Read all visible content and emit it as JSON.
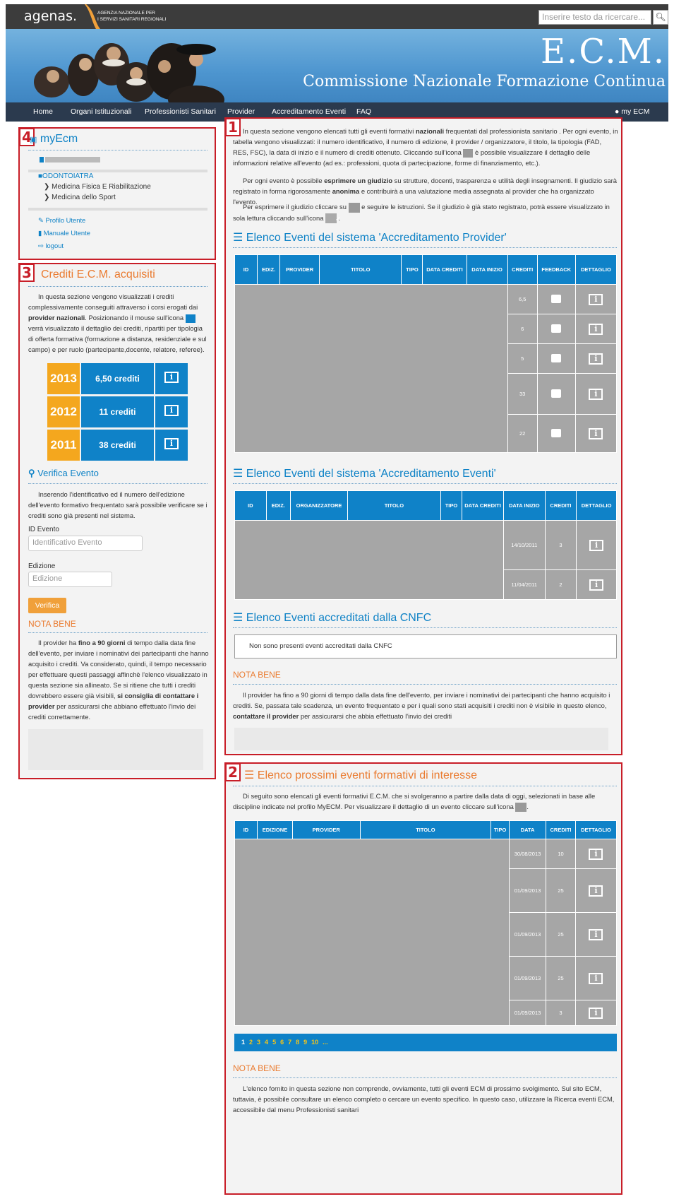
{
  "header": {
    "logo": "agenas.",
    "logo_sub_line1": "AGENZIA NAZIONALE PER",
    "logo_sub_line2": "I SERVIZI SANITARI REGIONALI",
    "search_placeholder": "Inserire testo da ricercare...",
    "banner_title": "E.C.M.",
    "banner_subtitle": "Commissione Nazionale Formazione Continua"
  },
  "nav": {
    "items": [
      "Home",
      "Organi Istituzionali",
      "Professionisti Sanitari",
      "Provider",
      "Accreditamento Eventi",
      "FAQ"
    ],
    "user": "my ECM"
  },
  "sidebar": {
    "badge4": "4",
    "title": "myEcm",
    "profession": "ODONTOIATRA",
    "disciplines": [
      "Medicina Fisica E Riabilitazione",
      "Medicina dello Sport"
    ],
    "links": [
      "Profilo Utente",
      "Manuale Utente",
      "logout"
    ]
  },
  "credits": {
    "badge3": "3",
    "title": "Crediti E.C.M. acquisiti",
    "intro_a": "In questa sezione vengono visualizzati i crediti complessivamente conseguiti attraverso i corsi erogati dai ",
    "intro_b": "provider nazionali",
    "intro_c": ". Posizionando il mouse sull'icona ",
    "intro_d": " verrà visualizzato il dettaglio dei crediti, ripartiti per tipologia di offerta formativa (formazione a distanza, residenziale e sul campo) e per ruolo (partecipante,docente, relatore, referee).",
    "years": [
      {
        "year": "2013",
        "credits": "6,50 crediti"
      },
      {
        "year": "2012",
        "credits": "11 crediti"
      },
      {
        "year": "2011",
        "credits": "38 crediti"
      }
    ],
    "verify_title": "Verifica Evento",
    "verify_text": "Inserendo l'identificativo ed il numero dell'edizione dell'evento formativo frequentato sarà possibile verificare se i crediti sono già presenti nel sistema.",
    "id_label": "ID Evento",
    "id_placeholder": "Identificativo Evento",
    "ed_label": "Edizione",
    "ed_placeholder": "Edizione",
    "verify_button": "Verifica",
    "nota_title": "NOTA BENE",
    "nota_a": "Il provider ha ",
    "nota_b": "fino a 90 giorni",
    "nota_c": " di tempo dalla data fine dell'evento, per inviare i nominativi dei partecipanti che hanno acquisito i crediti. Va considerato, quindi, il tempo necessario per effettuare questi passaggi affinchè l'elenco visualizzato in questa sezione sia allineato. Se si ritiene che tutti i crediti dovrebbero essere già visibili, ",
    "nota_d": "si consiglia di contattare i provider",
    "nota_e": " per assicurarsi che abbiano effettuato l'invio dei crediti correttamente."
  },
  "main": {
    "badge1": "1",
    "intro1_a": "In questa sezione vengono elencati tutti gli eventi formativi ",
    "intro1_b": "nazionali",
    "intro1_c": " frequentati dal professionista sanitario . Per ogni evento, in tabella vengono visualizzati: il numero identificativo, il numero di edizione, il provider / organizzatore, il titolo, la tipologia (FAD, RES, FSC), la data di inizio e il numero di crediti ottenuto. Cliccando sull'icona ",
    "intro1_d": " è possibile visualizzare il dettaglio delle informazioni relative all'evento (ad es.: professioni, quota di partecipazione, forme di finanziamento, etc.).",
    "intro2_a": "Per ogni evento è possibile ",
    "intro2_b": "esprimere un giudizio",
    "intro2_c": " su strutture, docenti, trasparenza e utilità degli insegnamenti. Il giudizio sarà registrato in forma rigorosamente ",
    "intro2_d": "anonima",
    "intro2_e": " e contribuirà a una valutazione media assegnata al provider che ha organizzato l'evento.",
    "intro3_a": "Per esprimere il giudizio cliccare su ",
    "intro3_b": " e seguire le istruzioni. Se il giudizio è già stato registrato, potrà essere visualizzato in sola lettura cliccando sull'icona ",
    "intro3_c": " .",
    "t1_title": "Elenco Eventi del sistema 'Accreditamento Provider'",
    "t1_headers": [
      "ID",
      "EDIZ.",
      "PROVIDER",
      "TITOLO",
      "TIPO",
      "DATA CREDITI",
      "DATA INIZIO",
      "CREDITI",
      "FEEDBACK",
      "DETTAGLIO"
    ],
    "t1_credits": [
      "6,5",
      "6",
      "5",
      "33",
      "22"
    ],
    "t2_title": "Elenco Eventi del sistema 'Accreditamento Eventi'",
    "t2_headers": [
      "ID",
      "EDIZ.",
      "ORGANIZZATORE",
      "TITOLO",
      "TIPO",
      "DATA CREDITI",
      "DATA INIZIO",
      "CREDITI",
      "DETTAGLIO"
    ],
    "t2_rows": [
      {
        "date": "14/10/2011",
        "credits": "3"
      },
      {
        "date": "11/04/2011",
        "credits": "2"
      }
    ],
    "t3_title": "Elenco Eventi accreditati dalla CNFC",
    "t3_empty": "Non sono presenti eventi accreditati dalla CNFC",
    "nota_title": "NOTA BENE",
    "nota_a": "Il provider ha fino a 90 giorni di tempo dalla data fine dell'evento, per inviare i nominativi dei partecipanti che hanno acquisito i crediti. Se, passata tale scadenza, un evento frequentato e per i quali sono stati acquisiti i crediti non è visibile in questo elenco, ",
    "nota_b": "contattare il provider",
    "nota_c": " per assicurarsi che abbia effettuato l'invio dei crediti"
  },
  "upcoming": {
    "badge2": "2",
    "title": "Elenco prossimi eventi formativi di interesse",
    "intro_a": "Di seguito sono elencati gli eventi formativi E.C.M. che si svolgeranno a partire dalla data di oggi, selezionati in base alle discipline indicate nel profilo MyECM. Per visualizzare il dettaglio di un evento cliccare sull'icona ",
    "intro_b": ".",
    "headers": [
      "ID",
      "EDIZIONE",
      "PROVIDER",
      "TITOLO",
      "TIPO",
      "DATA",
      "CREDITI",
      "DETTAGLIO"
    ],
    "rows": [
      {
        "date": "30/08/2013",
        "credits": "10"
      },
      {
        "date": "01/09/2013",
        "credits": "25"
      },
      {
        "date": "01/09/2013",
        "credits": "25"
      },
      {
        "date": "01/09/2013",
        "credits": "25"
      },
      {
        "date": "01/09/2013",
        "credits": "3"
      }
    ],
    "pages": [
      "1",
      "2",
      "3",
      "4",
      "5",
      "6",
      "7",
      "8",
      "9",
      "10",
      "..."
    ],
    "nota_title": "NOTA BENE",
    "nota_text": "L'elenco fornito in questa sezione non comprende, ovviamente, tutti gli eventi ECM di prossimo svolgimento. Sul sito ECM, tuttavia, è possibile consultare un elenco completo o cercare un evento specifico. In questo caso, utilizzare la Ricerca eventi ECM, accessibile dal menu Professionisti sanitari"
  },
  "colors": {
    "blue": "#0f82c8",
    "orange": "#f0a03a",
    "red": "#c81e28",
    "navy": "#2b3a4e"
  }
}
